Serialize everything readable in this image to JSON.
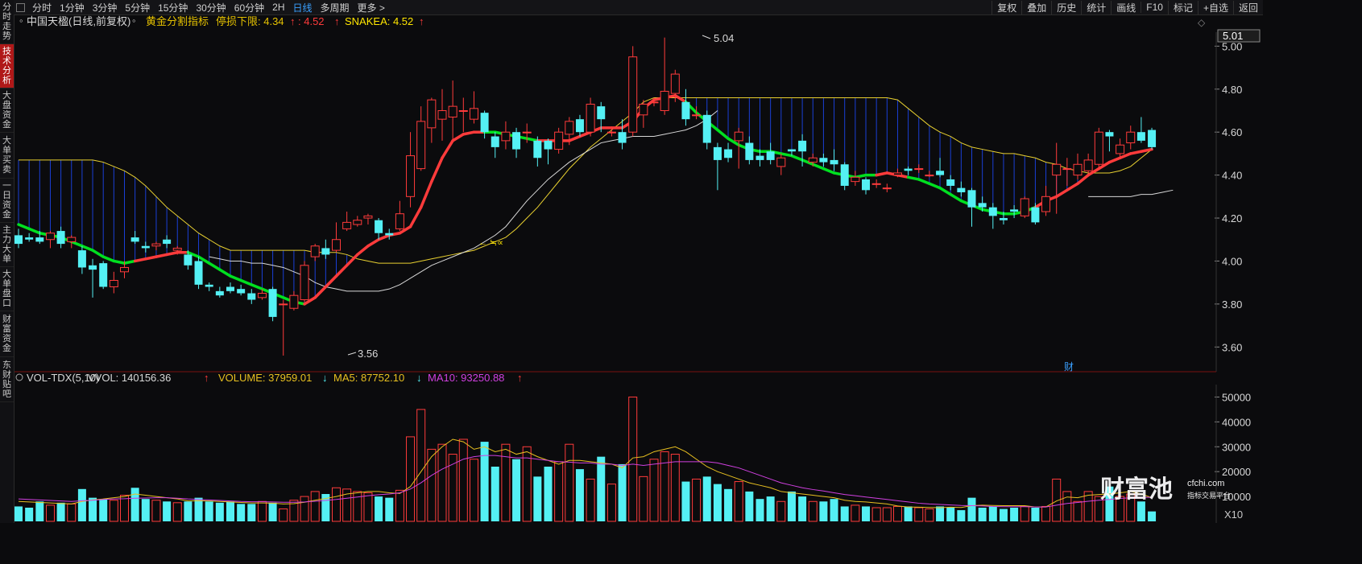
{
  "sidebar": {
    "tabs": [
      {
        "label": "分时走势",
        "active": false
      },
      {
        "label": "技术分析",
        "active": true
      },
      {
        "label": "大盘资金",
        "active": false
      },
      {
        "label": "大单买卖",
        "active": false
      },
      {
        "label": "一日资金",
        "active": false
      },
      {
        "label": "主力大单",
        "active": false
      },
      {
        "label": "大单盘口",
        "active": false
      },
      {
        "label": "财富资金",
        "active": false
      },
      {
        "label": "东财贴吧",
        "active": false
      }
    ]
  },
  "toolbar": {
    "periods": [
      "分时",
      "1分钟",
      "3分钟",
      "5分钟",
      "15分钟",
      "30分钟",
      "60分钟",
      "2H",
      "日线",
      "多周期",
      "更多 >"
    ],
    "active_period": "日线",
    "right_items": [
      "复权",
      "叠加",
      "历史",
      "统计",
      "画线",
      "F10",
      "标记",
      "+自选",
      "返回"
    ]
  },
  "price_header": {
    "stock_name": "中国天楹(日线,前复权)",
    "indicator_name": "黄金分割指标",
    "stop_label": "停损下限: 4.34",
    "stop_arrow": "↑",
    "mid_value": ": 4.52",
    "mid_arrow": "↑",
    "snakea_label": "SNAKEA: 4.52",
    "snakea_arrow": "↑"
  },
  "vol_header": {
    "name": "VOL-TDX(5,10)",
    "vvol": "VVOL: 140156.36",
    "vvol_arrow": "↑",
    "volume": "VOLUME: 37959.01",
    "volume_arrow": "↓",
    "ma5": "MA5: 87752.10",
    "ma5_arrow": "↓",
    "ma10": "MA10: 93250.88",
    "ma10_arrow": "↑"
  },
  "annotations": {
    "high_label": "5.04",
    "low_label": "3.56",
    "current_price_tag": "5.01",
    "cai_marker": "财",
    "x10_label": "X10",
    "small_marker": "← ≒∝"
  },
  "watermark": {
    "brand": "财富池",
    "domain": "cfchi.com",
    "tagline": "指标交易平台"
  },
  "colors": {
    "up": "#ff3b3b",
    "down": "#54f0f4",
    "yellow": "#ffe600",
    "green": "#00e020",
    "ma5": "#e8c020",
    "ma10": "#d040e0",
    "stop_line": "#e8d030",
    "white_line": "#d8d8d8"
  },
  "chart_data": {
    "type": "candlestick",
    "price_ylim": [
      3.5,
      5.05
    ],
    "price_yticks": [
      3.6,
      3.8,
      4.0,
      4.2,
      4.4,
      4.6,
      4.8,
      5.0
    ],
    "candles": [
      [
        4.12,
        4.08,
        4.15,
        4.06
      ],
      [
        4.11,
        4.1,
        4.13,
        4.09
      ],
      [
        4.11,
        4.09,
        4.14,
        4.08
      ],
      [
        4.1,
        4.13,
        4.14,
        4.06
      ],
      [
        4.14,
        4.08,
        4.16,
        4.06
      ],
      [
        4.09,
        4.11,
        4.12,
        4.06
      ],
      [
        4.05,
        3.97,
        4.07,
        3.94
      ],
      [
        3.98,
        3.96,
        4.01,
        3.83
      ],
      [
        3.99,
        3.88,
        4.0,
        3.87
      ],
      [
        3.88,
        3.91,
        3.95,
        3.85
      ],
      [
        3.95,
        3.97,
        4.0,
        3.92
      ],
      [
        4.11,
        4.09,
        4.14,
        4.08
      ],
      [
        4.07,
        4.06,
        4.09,
        4.04
      ],
      [
        4.07,
        4.08,
        4.09,
        4.05
      ],
      [
        4.1,
        4.08,
        4.12,
        4.06
      ],
      [
        4.05,
        4.06,
        4.07,
        4.03
      ],
      [
        4.03,
        3.98,
        4.05,
        3.96
      ],
      [
        4.0,
        3.89,
        4.02,
        3.87
      ],
      [
        3.89,
        3.88,
        3.9,
        3.86
      ],
      [
        3.86,
        3.84,
        3.88,
        3.83
      ],
      [
        3.88,
        3.86,
        3.9,
        3.85
      ],
      [
        3.87,
        3.85,
        3.89,
        3.84
      ],
      [
        3.85,
        3.82,
        3.87,
        3.8
      ],
      [
        3.83,
        3.85,
        3.87,
        3.82
      ],
      [
        3.87,
        3.74,
        3.88,
        3.72
      ],
      [
        3.8,
        3.8,
        3.82,
        3.56
      ],
      [
        3.78,
        3.84,
        3.86,
        3.77
      ],
      [
        3.82,
        3.98,
        4.0,
        3.81
      ],
      [
        4.02,
        4.07,
        4.08,
        4.0
      ],
      [
        4.06,
        4.03,
        4.1,
        4.01
      ],
      [
        4.05,
        4.1,
        4.18,
        4.04
      ],
      [
        4.15,
        4.18,
        4.23,
        4.14
      ],
      [
        4.17,
        4.19,
        4.21,
        4.16
      ],
      [
        4.2,
        4.21,
        4.22,
        4.17
      ],
      [
        4.19,
        4.13,
        4.2,
        4.1
      ],
      [
        4.13,
        4.12,
        4.15,
        4.1
      ],
      [
        4.15,
        4.22,
        4.28,
        4.14
      ],
      [
        4.3,
        4.49,
        4.6,
        4.25
      ],
      [
        4.43,
        4.65,
        4.72,
        4.42
      ],
      [
        4.62,
        4.75,
        4.76,
        4.55
      ],
      [
        4.66,
        4.7,
        4.8,
        4.56
      ],
      [
        4.67,
        4.72,
        4.84,
        4.55
      ],
      [
        4.7,
        4.7,
        4.76,
        4.6
      ],
      [
        4.66,
        4.71,
        4.79,
        4.64
      ],
      [
        4.69,
        4.6,
        4.7,
        4.57
      ],
      [
        4.58,
        4.53,
        4.6,
        4.48
      ],
      [
        4.56,
        4.6,
        4.65,
        4.52
      ],
      [
        4.6,
        4.52,
        4.62,
        4.48
      ],
      [
        4.6,
        4.6,
        4.64,
        4.55
      ],
      [
        4.56,
        4.48,
        4.58,
        4.44
      ],
      [
        4.56,
        4.52,
        4.57,
        4.45
      ],
      [
        4.52,
        4.6,
        4.62,
        4.5
      ],
      [
        4.59,
        4.65,
        4.67,
        4.54
      ],
      [
        4.66,
        4.6,
        4.68,
        4.58
      ],
      [
        4.6,
        4.73,
        4.76,
        4.58
      ],
      [
        4.72,
        4.66,
        4.74,
        4.6
      ],
      [
        4.6,
        4.6,
        4.62,
        4.58
      ],
      [
        4.6,
        4.55,
        4.66,
        4.52
      ],
      [
        4.6,
        4.95,
        5.0,
        4.58
      ],
      [
        4.68,
        4.73,
        4.75,
        4.62
      ],
      [
        4.74,
        4.74,
        4.76,
        4.72
      ],
      [
        4.7,
        4.79,
        5.04,
        4.68
      ],
      [
        4.78,
        4.87,
        4.89,
        4.74
      ],
      [
        4.74,
        4.66,
        4.8,
        4.63
      ],
      [
        4.68,
        4.68,
        4.72,
        4.66
      ],
      [
        4.68,
        4.55,
        4.7,
        4.52
      ],
      [
        4.53,
        4.47,
        4.55,
        4.33
      ],
      [
        4.52,
        4.48,
        4.55,
        4.46
      ],
      [
        4.56,
        4.6,
        4.62,
        4.43
      ],
      [
        4.55,
        4.47,
        4.58,
        4.45
      ],
      [
        4.49,
        4.47,
        4.52,
        4.44
      ],
      [
        4.51,
        4.47,
        4.55,
        4.45
      ],
      [
        4.44,
        4.48,
        4.5,
        4.4
      ],
      [
        4.52,
        4.51,
        4.52,
        4.49
      ],
      [
        4.56,
        4.51,
        4.59,
        4.44
      ],
      [
        4.46,
        4.48,
        4.5,
        4.44
      ],
      [
        4.48,
        4.46,
        4.5,
        4.44
      ],
      [
        4.47,
        4.45,
        4.52,
        4.42
      ],
      [
        4.45,
        4.35,
        4.46,
        4.33
      ],
      [
        4.37,
        4.39,
        4.42,
        4.35
      ],
      [
        4.38,
        4.33,
        4.39,
        4.31
      ],
      [
        4.36,
        4.36,
        4.38,
        4.34
      ],
      [
        4.34,
        4.34,
        4.36,
        4.32
      ],
      [
        4.4,
        4.41,
        4.43,
        4.39
      ],
      [
        4.43,
        4.42,
        4.44,
        4.4
      ],
      [
        4.43,
        4.43,
        4.45,
        4.41
      ],
      [
        4.4,
        4.4,
        4.42,
        4.39
      ],
      [
        4.42,
        4.4,
        4.48,
        4.39
      ],
      [
        4.38,
        4.35,
        4.4,
        4.33
      ],
      [
        4.34,
        4.32,
        4.37,
        4.3
      ],
      [
        4.33,
        4.25,
        4.34,
        4.16
      ],
      [
        4.27,
        4.25,
        4.3,
        4.23
      ],
      [
        4.25,
        4.21,
        4.27,
        4.15
      ],
      [
        4.2,
        4.19,
        4.23,
        4.17
      ],
      [
        4.24,
        4.23,
        4.26,
        4.2
      ],
      [
        4.21,
        4.29,
        4.3,
        4.2
      ],
      [
        4.25,
        4.18,
        4.27,
        4.17
      ],
      [
        4.23,
        4.3,
        4.35,
        4.21
      ],
      [
        4.4,
        4.45,
        4.55,
        4.22
      ],
      [
        4.43,
        4.43,
        4.48,
        4.35
      ],
      [
        4.4,
        4.45,
        4.5,
        4.38
      ],
      [
        4.42,
        4.47,
        4.5,
        4.41
      ],
      [
        4.45,
        4.6,
        4.62,
        4.43
      ],
      [
        4.6,
        4.58,
        4.61,
        4.51
      ],
      [
        4.5,
        4.54,
        4.57,
        4.48
      ],
      [
        4.55,
        4.6,
        4.63,
        4.52
      ],
      [
        4.6,
        4.56,
        4.67,
        4.55
      ],
      [
        4.61,
        4.53,
        4.62,
        4.52
      ]
    ],
    "snake_line": [
      4.17,
      4.15,
      4.13,
      4.12,
      4.11,
      4.09,
      4.07,
      4.05,
      4.02,
      4.0,
      3.99,
      4.0,
      4.01,
      4.02,
      4.03,
      4.04,
      4.04,
      4.02,
      3.99,
      3.96,
      3.93,
      3.91,
      3.89,
      3.87,
      3.85,
      3.83,
      3.81,
      3.8,
      3.83,
      3.88,
      3.93,
      3.98,
      4.03,
      4.07,
      4.1,
      4.12,
      4.13,
      4.16,
      4.25,
      4.37,
      4.48,
      4.56,
      4.59,
      4.6,
      4.6,
      4.6,
      4.59,
      4.58,
      4.57,
      4.56,
      4.56,
      4.56,
      4.56,
      4.58,
      4.6,
      4.62,
      4.62,
      4.62,
      4.65,
      4.71,
      4.75,
      4.76,
      4.77,
      4.74,
      4.69,
      4.65,
      4.61,
      4.57,
      4.54,
      4.52,
      4.51,
      4.51,
      4.5,
      4.49,
      4.47,
      4.45,
      4.43,
      4.41,
      4.4,
      4.39,
      4.4,
      4.4,
      4.41,
      4.4,
      4.39,
      4.38,
      4.36,
      4.34,
      4.31,
      4.28,
      4.26,
      4.24,
      4.23,
      4.22,
      4.22,
      4.23,
      4.25,
      4.28,
      4.3,
      4.33,
      4.36,
      4.4,
      4.43,
      4.46,
      4.48,
      4.5,
      4.51,
      4.52
    ],
    "snake_colors": [
      "green",
      "green",
      "green",
      "green",
      "green",
      "green",
      "green",
      "green",
      "green",
      "green",
      "green",
      "red",
      "red",
      "red",
      "red",
      "red",
      "green",
      "green",
      "green",
      "green",
      "green",
      "green",
      "green",
      "green",
      "green",
      "green",
      "green",
      "red",
      "red",
      "red",
      "red",
      "red",
      "red",
      "red",
      "red",
      "red",
      "red",
      "red",
      "red",
      "red",
      "red",
      "red",
      "red",
      "red",
      "green",
      "green",
      "green",
      "green",
      "green",
      "red",
      "red",
      "red",
      "red",
      "red",
      "red",
      "red",
      "red",
      "red",
      "red",
      "red",
      "red",
      "red",
      "red",
      "green",
      "green",
      "green",
      "green",
      "green",
      "green",
      "green",
      "green",
      "green",
      "green",
      "green",
      "green",
      "green",
      "green",
      "green",
      "green",
      "green",
      "green",
      "red",
      "red",
      "red",
      "green",
      "green",
      "green",
      "green",
      "green",
      "green",
      "green",
      "green",
      "green",
      "green",
      "green",
      "green",
      "red",
      "red",
      "red",
      "red",
      "red",
      "red",
      "red",
      "red",
      "red",
      "red",
      "red",
      "red"
    ],
    "stop_line": [
      4.47,
      4.47,
      4.47,
      4.47,
      4.47,
      4.47,
      4.47,
      4.47,
      4.46,
      4.44,
      4.42,
      4.39,
      4.35,
      4.3,
      4.25,
      4.21,
      4.17,
      4.13,
      4.1,
      4.07,
      4.05,
      4.05,
      4.05,
      4.05,
      4.05,
      4.05,
      4.05,
      4.05,
      4.04,
      4.04,
      4.04,
      4.03,
      4.01,
      4.0,
      3.99,
      3.99,
      3.99,
      3.99,
      4.0,
      4.01,
      4.02,
      4.03,
      4.04,
      4.05,
      4.07,
      4.09,
      4.11,
      4.15,
      4.2,
      4.25,
      4.31,
      4.37,
      4.43,
      4.48,
      4.53,
      4.57,
      4.61,
      4.65,
      4.69,
      4.74,
      4.76,
      4.76,
      4.76,
      4.76,
      4.76,
      4.76,
      4.76,
      4.76,
      4.76,
      4.76,
      4.76,
      4.76,
      4.76,
      4.76,
      4.76,
      4.76,
      4.76,
      4.76,
      4.76,
      4.76,
      4.76,
      4.76,
      4.76,
      4.75,
      4.71,
      4.67,
      4.63,
      4.6,
      4.58,
      4.55,
      4.53,
      4.52,
      4.51,
      4.5,
      4.5,
      4.49,
      4.48,
      4.46,
      4.45,
      4.43,
      4.42,
      4.41,
      4.41,
      4.41,
      4.42,
      4.44,
      4.48,
      4.52
    ],
    "white_line": [
      null,
      null,
      null,
      null,
      null,
      null,
      null,
      null,
      null,
      null,
      null,
      null,
      null,
      null,
      null,
      null,
      null,
      null,
      4.02,
      4.01,
      4.0,
      4.0,
      3.99,
      3.99,
      3.98,
      3.97,
      3.95,
      3.93,
      3.9,
      3.88,
      3.87,
      3.86,
      3.86,
      3.86,
      3.86,
      3.87,
      3.89,
      3.92,
      3.95,
      3.98,
      4.0,
      4.02,
      4.04,
      4.06,
      4.09,
      4.12,
      4.16,
      4.22,
      4.28,
      4.33,
      4.38,
      4.42,
      4.46,
      4.49,
      4.52,
      4.55,
      4.56,
      4.57,
      4.58,
      4.58,
      4.58,
      4.59,
      4.6,
      4.61,
      4.63,
      4.66,
      4.7,
      null,
      null,
      null,
      null,
      null,
      null,
      null,
      null,
      null,
      null,
      null,
      null,
      null,
      null,
      null,
      null,
      null,
      null,
      null,
      null,
      null,
      null,
      null,
      null,
      null,
      null,
      null,
      null,
      null,
      null,
      null,
      null,
      null,
      null,
      4.3,
      4.3,
      4.3,
      4.3,
      4.3,
      4.31,
      4.31,
      4.32,
      4.33
    ],
    "volume_ylim": [
      0,
      55000
    ],
    "volume_yticks": [
      10000,
      20000,
      30000,
      40000,
      50000
    ],
    "volume": [
      6000,
      5500,
      8000,
      6500,
      7500,
      7000,
      13000,
      9500,
      9000,
      8500,
      10500,
      13500,
      9000,
      8500,
      8000,
      7500,
      8000,
      9500,
      8000,
      7500,
      8000,
      7000,
      7000,
      8000,
      7500,
      5000,
      8500,
      10000,
      12000,
      11000,
      13500,
      13000,
      12000,
      11500,
      10000,
      9500,
      12500,
      34000,
      45000,
      29000,
      31000,
      27000,
      33000,
      25000,
      32000,
      22000,
      31000,
      25000,
      30000,
      18000,
      22000,
      24000,
      31000,
      21000,
      17000,
      26000,
      15000,
      23000,
      50000,
      18000,
      25000,
      28000,
      27000,
      16000,
      17000,
      18000,
      15000,
      13000,
      16000,
      12000,
      9000,
      10000,
      8000,
      12000,
      10000,
      8000,
      8000,
      9000,
      6000,
      6500,
      6000,
      5500,
      5500,
      6000,
      6000,
      5500,
      5000,
      6000,
      5500,
      4500,
      9500,
      5500,
      6000,
      5000,
      5500,
      6000,
      5500,
      6000,
      17000,
      12000,
      8000,
      12000,
      10000,
      14000,
      10000,
      11000,
      8000,
      4000
    ],
    "ma5": [
      8000,
      7800,
      7600,
      7400,
      7200,
      7000,
      8000,
      8600,
      9000,
      9500,
      10000,
      11000,
      10500,
      10000,
      9500,
      9000,
      8200,
      8300,
      8200,
      8000,
      7800,
      7600,
      7400,
      7400,
      7300,
      7000,
      7100,
      7700,
      8500,
      9200,
      10000,
      11000,
      11500,
      12000,
      12000,
      11500,
      11200,
      14000,
      20000,
      26000,
      30000,
      33000,
      32000,
      29000,
      30000,
      28000,
      29000,
      27000,
      28000,
      26000,
      24500,
      23000,
      24500,
      24500,
      24000,
      23500,
      23000,
      21500,
      25500,
      26000,
      28000,
      29000,
      30000,
      28000,
      25000,
      22000,
      20000,
      18500,
      17000,
      15500,
      14500,
      13500,
      12000,
      11500,
      11000,
      10500,
      10000,
      9500,
      8500,
      8000,
      7800,
      7400,
      7000,
      6200,
      5800,
      5700,
      5600,
      5500,
      5700,
      5600,
      6300,
      6500,
      6400,
      6300,
      6300,
      6300,
      5800,
      5800,
      8200,
      9800,
      9500,
      10500,
      10800,
      11000,
      11500,
      12000,
      11000,
      9500
    ],
    "ma10": [
      9000,
      8800,
      8600,
      8400,
      8200,
      8000,
      8300,
      8500,
      8800,
      9000,
      9100,
      9300,
      9400,
      9500,
      9500,
      9300,
      9000,
      8800,
      8600,
      8400,
      8200,
      8000,
      7900,
      7900,
      7800,
      7700,
      7700,
      7800,
      8100,
      8400,
      8800,
      9300,
      9800,
      10300,
      10700,
      11000,
      11500,
      13000,
      15500,
      18500,
      21000,
      23000,
      25000,
      26000,
      26500,
      26500,
      26000,
      25500,
      25500,
      25000,
      24500,
      24000,
      23800,
      23500,
      23500,
      23000,
      23000,
      22500,
      23000,
      22500,
      23000,
      23500,
      24000,
      24000,
      24000,
      24000,
      23500,
      22500,
      21500,
      20000,
      18500,
      17000,
      15500,
      14500,
      13500,
      12800,
      12200,
      11500,
      10800,
      10300,
      9800,
      9300,
      8800,
      8300,
      7800,
      7300,
      7000,
      6800,
      6600,
      6400,
      6300,
      6200,
      6000,
      5900,
      5900,
      5900,
      5800,
      5800,
      6500,
      7200,
      7600,
      8100,
      8500,
      8800,
      9200,
      9500,
      9600,
      9700
    ]
  }
}
